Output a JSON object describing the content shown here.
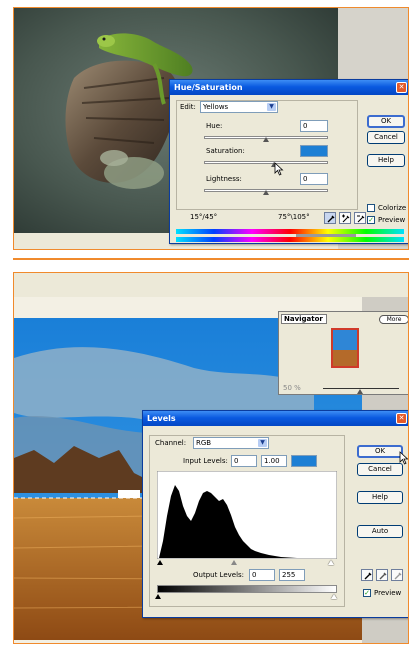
{
  "hue_saturation": {
    "title": "Hue/Saturation",
    "edit_label": "Edit:",
    "edit_value": "Yellows",
    "hue_label": "Hue:",
    "hue_value": "0",
    "saturation_label": "Saturation:",
    "lightness_label": "Lightness:",
    "lightness_value": "0",
    "ok_label": "OK",
    "cancel_label": "Cancel",
    "help_label": "Help",
    "colorize_label": "Colorize",
    "preview_label": "Preview",
    "range_left": "15°/45°",
    "range_right": "75°\\105°",
    "colors": {
      "accent_field": "#1d7fd4"
    }
  },
  "navigator": {
    "title": "Navigator",
    "more_label": "More",
    "zoom_value": "50 %"
  },
  "levels": {
    "title": "Levels",
    "channel_label": "Channel:",
    "channel_value": "RGB",
    "input_levels_label": "Input Levels:",
    "input_black": "0",
    "input_gamma": "1.00",
    "output_levels_label": "Output Levels:",
    "output_black": "0",
    "output_white": "255",
    "ok_label": "OK",
    "cancel_label": "Cancel",
    "help_label": "Help",
    "auto_label": "Auto",
    "preview_label": "Preview"
  },
  "icons": [
    "close-icon",
    "eyedropper-icon",
    "eyedropper-plus-icon",
    "eyedropper-minus-icon",
    "cursor-arrow-icon",
    "dropdown-arrow-icon",
    "slider-triangle-icon"
  ]
}
